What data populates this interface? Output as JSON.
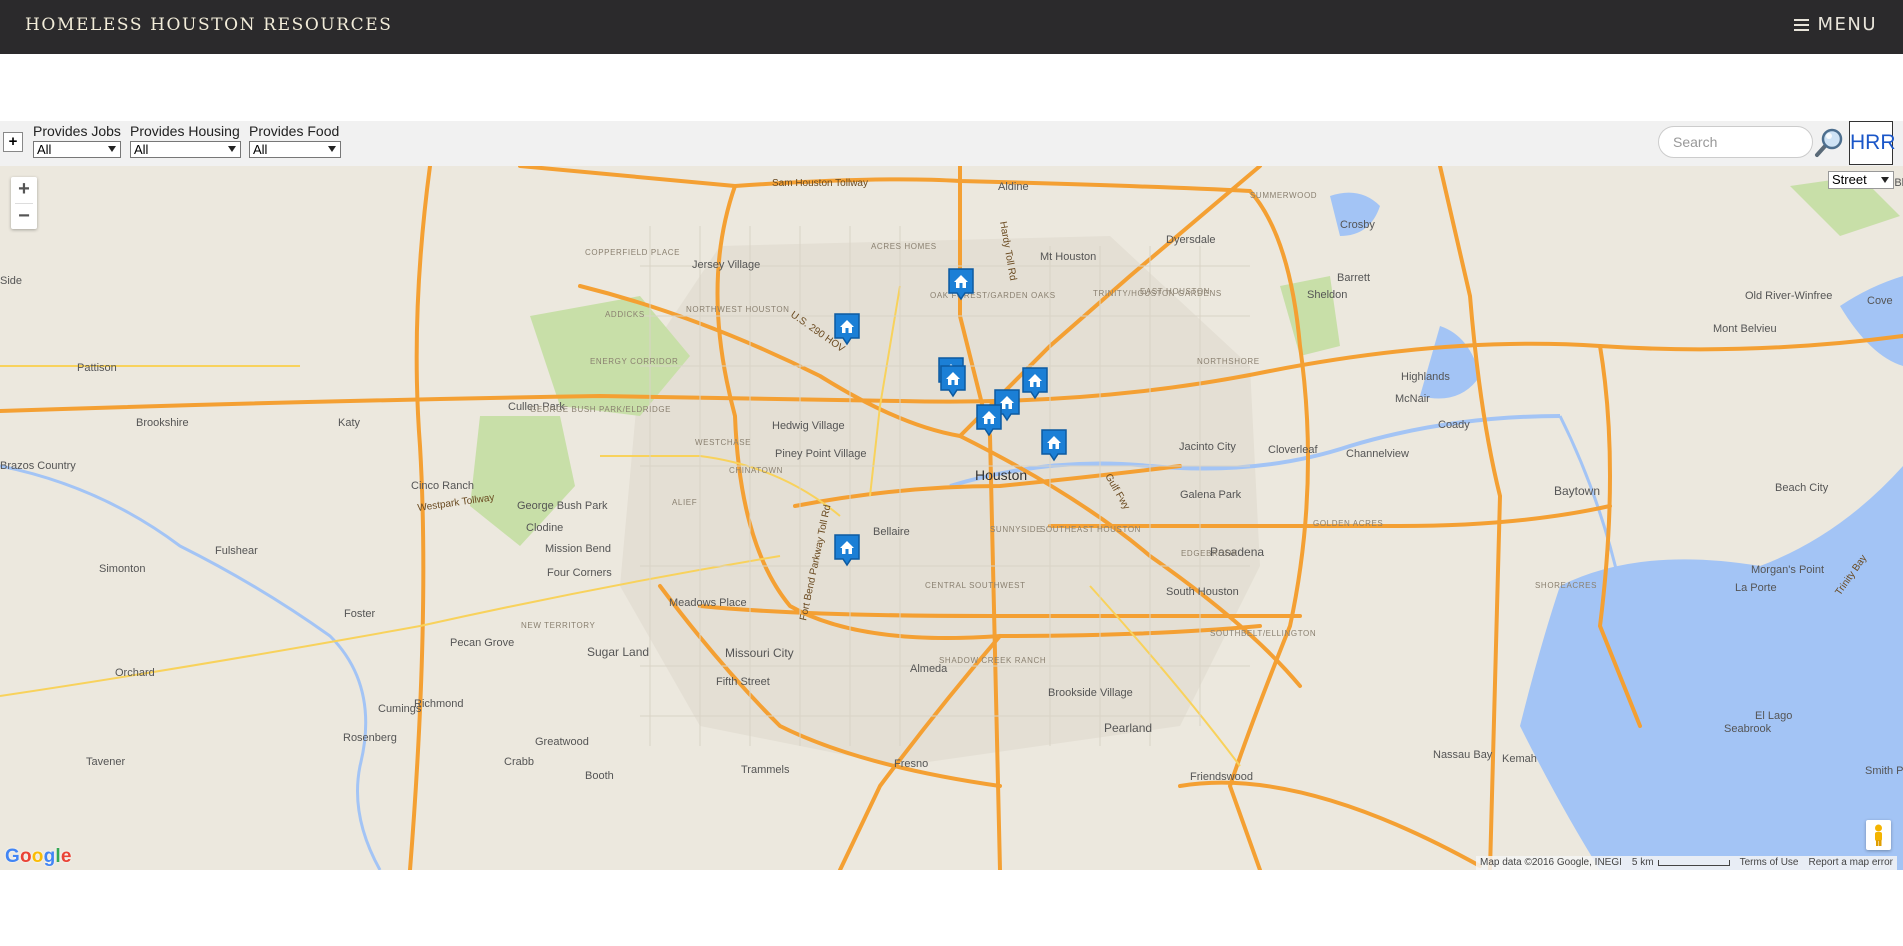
{
  "header": {
    "title": "HOMELESS HOUSTON RESOURCES",
    "menu_label": "MENU"
  },
  "filters": {
    "expand_label": "+",
    "items": [
      {
        "label": "Provides Jobs",
        "value": "All"
      },
      {
        "label": "Provides Housing",
        "value": "All"
      },
      {
        "label": "Provides Food",
        "value": "All"
      }
    ],
    "search_placeholder": "Search",
    "logo_text": "HRR"
  },
  "map": {
    "zoom_in": "+",
    "zoom_out": "−",
    "map_type": "Street",
    "attribution": "Map data ©2016 Google, INEGI",
    "scale": "5 km",
    "terms": "Terms of Use",
    "report": "Report a map error",
    "logo": "Google",
    "places": [
      {
        "name": "Aldine",
        "cls": "small"
      },
      {
        "name": "Jersey Village",
        "cls": "small"
      },
      {
        "name": "Mt Houston",
        "cls": "small"
      },
      {
        "name": "Dyersdale",
        "cls": "small"
      },
      {
        "name": "Crosby",
        "cls": "small"
      },
      {
        "name": "Barrett",
        "cls": "small"
      },
      {
        "name": "Sheldon",
        "cls": "small"
      },
      {
        "name": "Old River-Winfree",
        "cls": "small"
      },
      {
        "name": "Mont Belvieu",
        "cls": "small"
      },
      {
        "name": "Pattison",
        "cls": "small"
      },
      {
        "name": "Highlands",
        "cls": "small"
      },
      {
        "name": "McNair",
        "cls": "small"
      },
      {
        "name": "Brookshire",
        "cls": "small"
      },
      {
        "name": "Katy",
        "cls": "small"
      },
      {
        "name": "Cullen Park",
        "cls": "small"
      },
      {
        "name": "Hedwig Village",
        "cls": "small"
      },
      {
        "name": "Cloverleaf",
        "cls": "small"
      },
      {
        "name": "Channelview",
        "cls": "small"
      },
      {
        "name": "Coady",
        "cls": "small"
      },
      {
        "name": "Piney Point Village",
        "cls": "small"
      },
      {
        "name": "Houston",
        "cls": "big"
      },
      {
        "name": "Jacinto City",
        "cls": "small"
      },
      {
        "name": "Brazos Country",
        "cls": "small"
      },
      {
        "name": "Cinco Ranch",
        "cls": "small"
      },
      {
        "name": "George Bush Park",
        "cls": "small"
      },
      {
        "name": "Galena Park",
        "cls": "small"
      },
      {
        "name": "Baytown",
        "cls": "mid"
      },
      {
        "name": "Beach City",
        "cls": "small"
      },
      {
        "name": "Clodine",
        "cls": "small"
      },
      {
        "name": "Bellaire",
        "cls": "small"
      },
      {
        "name": "Fulshear",
        "cls": "small"
      },
      {
        "name": "Mission Bend",
        "cls": "small"
      },
      {
        "name": "Pasadena",
        "cls": "mid"
      },
      {
        "name": "Simonton",
        "cls": "small"
      },
      {
        "name": "Four Corners",
        "cls": "small"
      },
      {
        "name": "Morgan's Point",
        "cls": "small"
      },
      {
        "name": "South Houston",
        "cls": "small"
      },
      {
        "name": "La Porte",
        "cls": "small"
      },
      {
        "name": "Meadows Place",
        "cls": "small"
      },
      {
        "name": "Foster",
        "cls": "small"
      },
      {
        "name": "Pecan Grove",
        "cls": "small"
      },
      {
        "name": "Sugar Land",
        "cls": "mid"
      },
      {
        "name": "Missouri City",
        "cls": "mid"
      },
      {
        "name": "Fifth Street",
        "cls": "small"
      },
      {
        "name": "Orchard",
        "cls": "small"
      },
      {
        "name": "Almeda",
        "cls": "small"
      },
      {
        "name": "Brookside Village",
        "cls": "small"
      },
      {
        "name": "Cumings",
        "cls": "small"
      },
      {
        "name": "Richmond",
        "cls": "small"
      },
      {
        "name": "Pearland",
        "cls": "mid"
      },
      {
        "name": "El Lago",
        "cls": "small"
      },
      {
        "name": "Seabrook",
        "cls": "small"
      },
      {
        "name": "Rosenberg",
        "cls": "small"
      },
      {
        "name": "Greatwood",
        "cls": "small"
      },
      {
        "name": "Tavener",
        "cls": "small"
      },
      {
        "name": "Crabb",
        "cls": "small"
      },
      {
        "name": "Fresno",
        "cls": "small"
      },
      {
        "name": "Trammels",
        "cls": "small"
      },
      {
        "name": "Nassau Bay",
        "cls": "small"
      },
      {
        "name": "Kemah",
        "cls": "small"
      },
      {
        "name": "Booth",
        "cls": "small"
      },
      {
        "name": "Friendswood",
        "cls": "small"
      },
      {
        "name": "Cove",
        "cls": "small"
      },
      {
        "name": "Side",
        "cls": "small"
      },
      {
        "name": "Smith Point",
        "cls": "small"
      },
      {
        "name": "Moss Bluff",
        "cls": "small"
      }
    ],
    "areas": [
      "COPPERFIELD PLACE",
      "ACRES HOMES",
      "OAK FOREST/GARDEN OAKS",
      "TRINITY/HOUSTON GARDENS",
      "EAST HOUSTON",
      "NORTHWEST HOUSTON",
      "ADDICKS",
      "ENERGY CORRIDOR",
      "NORTHSHORE",
      "GEORGE BUSH PARK/ELDRIDGE",
      "WESTCHASE",
      "CHINATOWN",
      "ALIEF",
      "SUNNYSIDE",
      "SOUTHEAST HOUSTON",
      "GOLDEN ACRES",
      "EDGEBROOK",
      "SHOREACRES",
      "CENTRAL SOUTHWEST",
      "NEW TERRITORY",
      "SOUTHBELT/ELLINGTON",
      "SHADOW CREEK RANCH",
      "SUMMERWOOD"
    ],
    "road_labels": [
      "Sam Houston Tollway",
      "Westpark Tollway",
      "Hardy Toll Rd",
      "U.S. 290 HOV",
      "Gulf Fwy",
      "Fort Bend Parkway Toll Rd",
      "Trinity Bay"
    ],
    "markers": [
      {
        "name": "shelter-1"
      },
      {
        "name": "shelter-2"
      },
      {
        "name": "shelter-3"
      },
      {
        "name": "shelter-4"
      },
      {
        "name": "shelter-5"
      },
      {
        "name": "shelter-6"
      },
      {
        "name": "shelter-7"
      },
      {
        "name": "shelter-8"
      },
      {
        "name": "shelter-9"
      }
    ],
    "colors": {
      "land": "#ece8de",
      "water": "#a3c4f5",
      "highway": "#f4a033",
      "park": "#c8dfa8",
      "marker": "#1b7fd6"
    }
  }
}
